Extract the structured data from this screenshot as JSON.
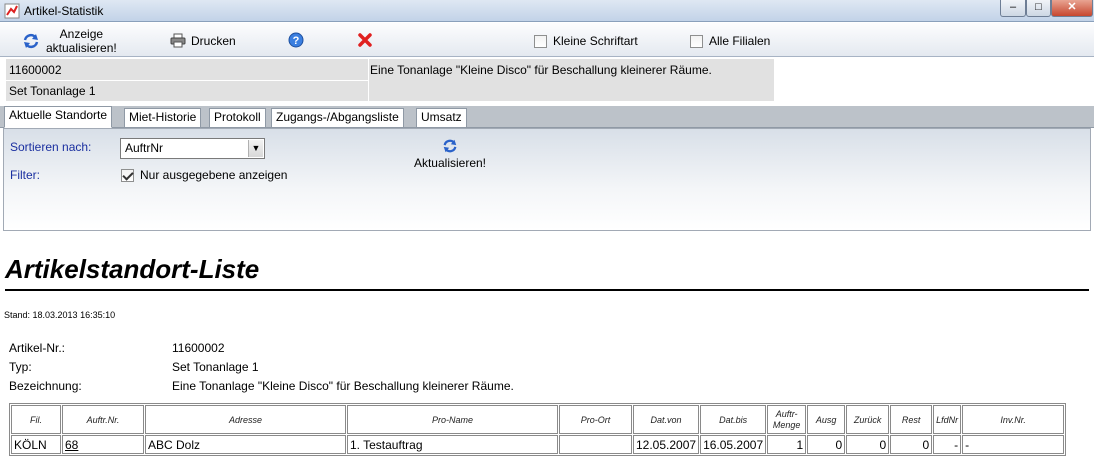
{
  "window": {
    "title": "Artikel-Statistik",
    "buttons": {
      "minimize": "–",
      "maximize": "□",
      "close": "✕"
    }
  },
  "toolbar": {
    "refresh_label_line1": "Anzeige",
    "refresh_label_line2": "aktualisieren!",
    "print_label": "Drucken",
    "small_font_label": "Kleine Schriftart",
    "small_font_checked": false,
    "all_branches_label": "Alle Filialen",
    "all_branches_checked": false
  },
  "article": {
    "number": "11600002",
    "type": "Set Tonanlage 1",
    "description": "Eine Tonanlage \"Kleine Disco\" für Beschallung kleinerer Räume."
  },
  "tabs": [
    {
      "label": "Aktuelle Standorte",
      "active": true
    },
    {
      "label": "Miet-Historie",
      "active": false
    },
    {
      "label": "Protokoll",
      "active": false
    },
    {
      "label": "Zugangs-/Abgangsliste",
      "active": false
    },
    {
      "label": "Umsatz",
      "active": false
    }
  ],
  "filters": {
    "sort_label": "Sortieren nach:",
    "sort_value": "AuftrNr",
    "filter_label": "Filter:",
    "only_issued_label": "Nur ausgegebene anzeigen",
    "only_issued_checked": true,
    "refresh_label": "Aktualisieren!"
  },
  "report": {
    "title": "Artikelstandort-Liste",
    "stand": "Stand: 18.03.2013 16:35:10",
    "fields": [
      {
        "label": "Artikel-Nr.:",
        "value": "11600002"
      },
      {
        "label": "Typ:",
        "value": "Set Tonanlage 1"
      },
      {
        "label": "Bezeichnung:",
        "value": "Eine Tonanlage \"Kleine Disco\" für Beschallung kleinerer Räume."
      }
    ],
    "columns": [
      "Fil.",
      "Auftr.Nr.",
      "Adresse",
      "Pro-Name",
      "Pro-Ort",
      "Dat.von",
      "Dat.bis",
      "Auftr-Menge",
      "Ausg",
      "Zurück",
      "Rest",
      "LfdNr",
      "Inv.Nr."
    ],
    "rows": [
      [
        "KÖLN",
        "68",
        "ABC Dolz",
        "1. Testauftrag",
        "",
        "12.05.2007",
        "16.05.2007",
        "1",
        "0",
        "0",
        "0",
        "-",
        "-"
      ]
    ]
  },
  "colors": {
    "label_blue": "#1a2fa0",
    "close_red": "#e02020"
  }
}
